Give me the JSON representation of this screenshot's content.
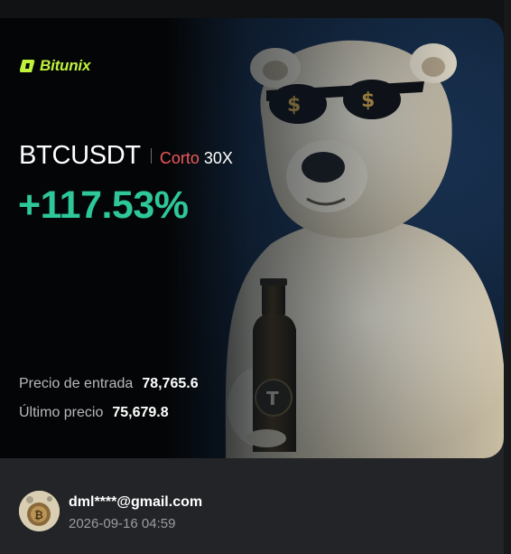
{
  "brand": {
    "name": "Bitunix",
    "color": "#bff23d",
    "icon": "bitunix-logo-icon"
  },
  "trade": {
    "pair": "BTCUSDT",
    "side": "Corto",
    "leverage": "30X",
    "pnl": "+117.53%",
    "side_color": "#ef5a58",
    "pnl_color": "#2ec79a"
  },
  "stats": {
    "entry_label": "Precio de entrada",
    "entry_value": "78,765.6",
    "last_label": "Último precio",
    "last_value": "75,679.8"
  },
  "user": {
    "email": "dml****@gmail.com",
    "timestamp": "2026-09-16 04:59",
    "avatar_icon": "user-avatar"
  },
  "illustration": {
    "icon": "polar-bear-sunglasses-beer-icon"
  }
}
